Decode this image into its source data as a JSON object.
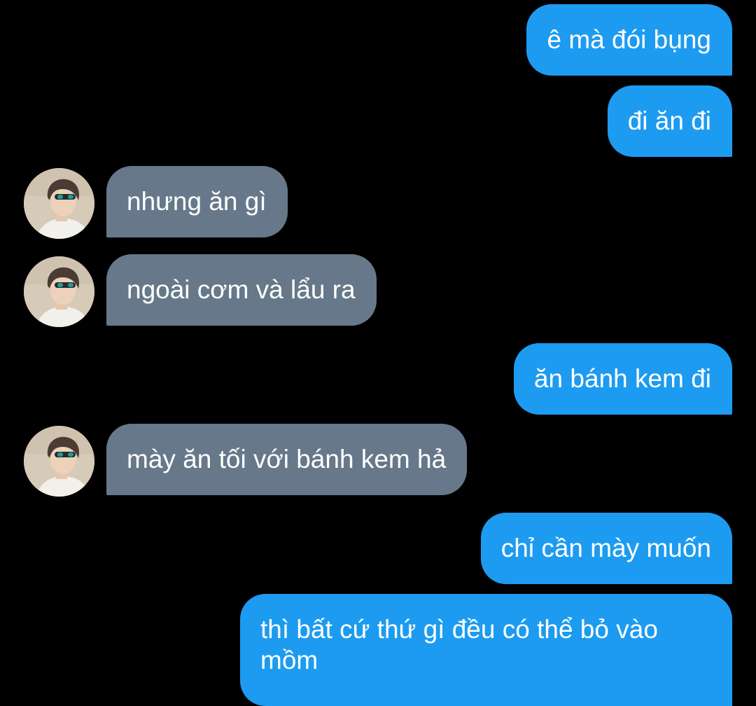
{
  "colors": {
    "background": "#000000",
    "sent_bubble": "#1d9bf0",
    "received_bubble": "#66788a",
    "text": "#ffffff"
  },
  "avatar_icon": "user-avatar-photo",
  "messages": [
    {
      "direction": "sent",
      "text": "ê mà đói bụng"
    },
    {
      "direction": "sent",
      "text": "đi ăn đi"
    },
    {
      "direction": "received",
      "text": "nhưng ăn gì"
    },
    {
      "direction": "received",
      "text": "ngoài cơm và lẩu ra"
    },
    {
      "direction": "sent",
      "text": "ăn bánh kem đi"
    },
    {
      "direction": "received",
      "text": "mày ăn tối với bánh kem hả"
    },
    {
      "direction": "sent",
      "text": "chỉ cần mày muốn"
    },
    {
      "direction": "sent",
      "text": "thì bất cứ thứ gì đều có thể bỏ vào mồm"
    }
  ]
}
